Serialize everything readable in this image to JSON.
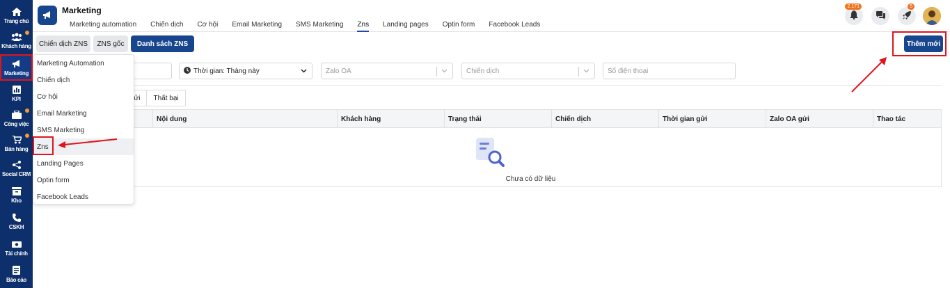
{
  "sidebar": {
    "items": [
      {
        "label": "Trang chủ",
        "icon": "home-icon"
      },
      {
        "label": "Khách hàng",
        "icon": "users-icon"
      },
      {
        "label": "Marketing",
        "icon": "megaphone-icon"
      },
      {
        "label": "KPI",
        "icon": "chart-icon"
      },
      {
        "label": "Công việc",
        "icon": "briefcase-icon"
      },
      {
        "label": "Bán hàng",
        "icon": "cart-icon"
      },
      {
        "label": "Social CRM",
        "icon": "share-icon"
      },
      {
        "label": "Kho",
        "icon": "warehouse-icon"
      },
      {
        "label": "CSKH",
        "icon": "phone-icon"
      },
      {
        "label": "Tài chính",
        "icon": "money-icon"
      },
      {
        "label": "Báo cáo",
        "icon": "report-icon"
      }
    ]
  },
  "header": {
    "title": "Marketing",
    "tabs": [
      "Marketing automation",
      "Chiến dịch",
      "Cơ hội",
      "Email Marketing",
      "SMS Marketing",
      "Zns",
      "Landing pages",
      "Optin form",
      "Facebook Leads"
    ],
    "notification_count": "2.171",
    "rocket_count": "5"
  },
  "toolbar": {
    "chip_campaign": "Chiến dịch ZNS",
    "chip_origin": "ZNS gốc",
    "chip_list": "Danh sách ZNS",
    "add_label": "Thêm mới"
  },
  "filters": {
    "time_label": "Thời gian: Tháng này",
    "zalo_placeholder": "Zalo OA",
    "campaign_placeholder": "Chiến dịch",
    "phone_placeholder": "Số điện thoại"
  },
  "status_tabs": [
    "gửi",
    "Thất bại"
  ],
  "table": {
    "columns": [
      "Nội dung",
      "Khách hàng",
      "Trạng thái",
      "Chiến dịch",
      "Thời gian gửi",
      "Zalo OA gửi",
      "Thao tác"
    ],
    "empty_text": "Chưa có dữ liệu"
  },
  "dropdown": {
    "items": [
      "Marketing Automation",
      "Chiến dịch",
      "Cơ hội",
      "Email Marketing",
      "SMS Marketing",
      "Zns",
      "Landing Pages",
      "Optin form",
      "Facebook Leads"
    ]
  },
  "colors": {
    "sidebar": "#0d2f6b",
    "primary": "#17468f",
    "highlight": "#e0141b",
    "badge": "#f2711c"
  }
}
